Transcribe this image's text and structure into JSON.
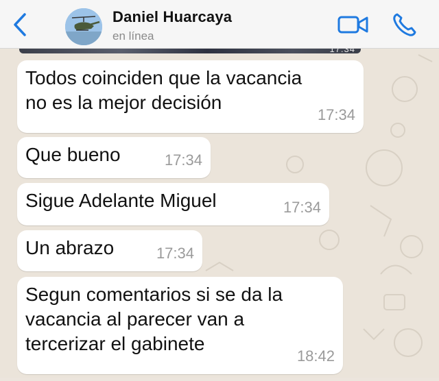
{
  "header": {
    "contact_name": "Daniel Huarcaya",
    "status": "en línea",
    "back_icon": "chevron-left-icon",
    "video_icon": "video-camera-icon",
    "call_icon": "phone-icon",
    "accent_color": "#1f7ae0"
  },
  "previous_media": {
    "time": "17:34"
  },
  "messages": [
    {
      "text": "Todos coinciden que la vacancia\nno es la mejor decisión",
      "time": "17:34"
    },
    {
      "text": "Que bueno",
      "time": "17:34"
    },
    {
      "text": "Sigue Adelante Miguel",
      "time": "17:34"
    },
    {
      "text": "Un abrazo",
      "time": "17:34"
    },
    {
      "text": "Segun comentarios si se da la\nvacancia al parecer van a\ntercerizar el gabinete",
      "time": "18:42"
    }
  ]
}
